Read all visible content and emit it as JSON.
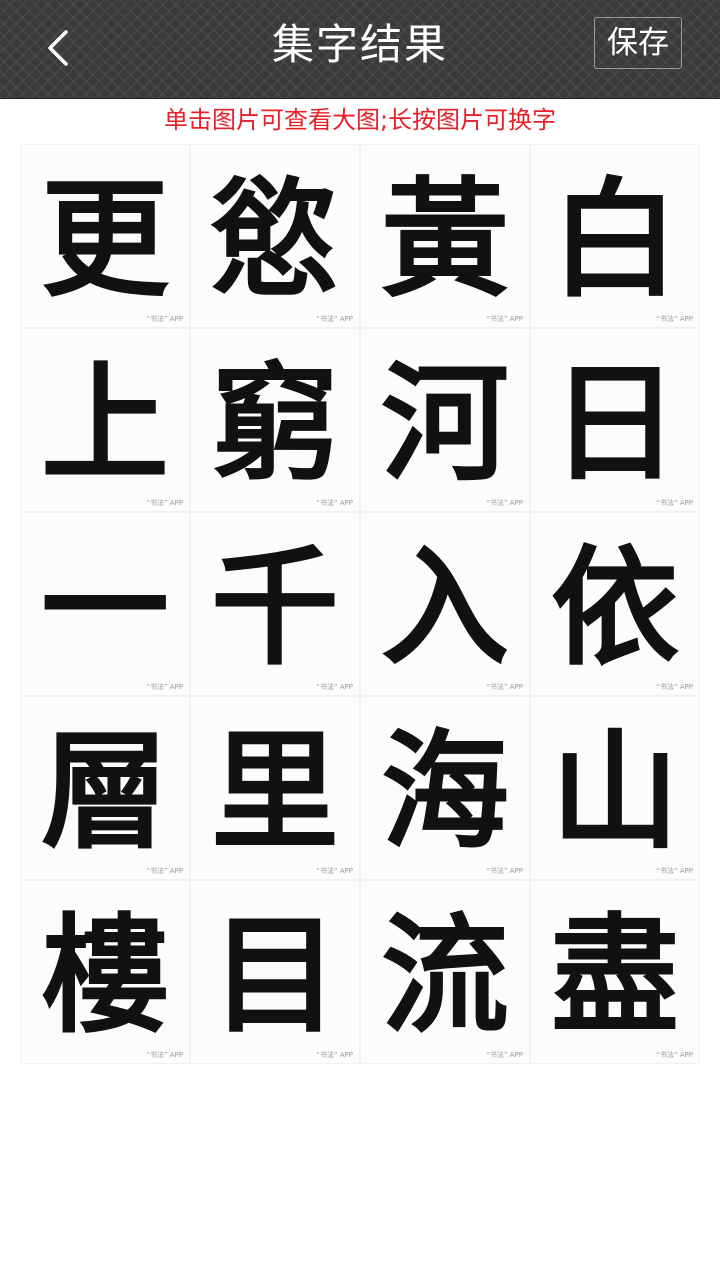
{
  "header": {
    "title": "集字结果",
    "save_label": "保存",
    "back_icon": "chevron-left-icon"
  },
  "hint": "单击图片可查看大图;长按图片可换字",
  "characters": [
    {
      "char": "更",
      "watermark": "“书法” APP"
    },
    {
      "char": "慾",
      "watermark": "“书法” APP"
    },
    {
      "char": "黃",
      "watermark": "“书法” APP"
    },
    {
      "char": "白",
      "watermark": "“书法” APP"
    },
    {
      "char": "上",
      "watermark": "“书法” APP"
    },
    {
      "char": "窮",
      "watermark": "“书法” APP"
    },
    {
      "char": "河",
      "watermark": "“书法” APP"
    },
    {
      "char": "日",
      "watermark": "“书法” APP"
    },
    {
      "char": "一",
      "watermark": "“书法” APP"
    },
    {
      "char": "千",
      "watermark": "“书法” APP"
    },
    {
      "char": "入",
      "watermark": "“书法” APP"
    },
    {
      "char": "依",
      "watermark": "“书法” APP"
    },
    {
      "char": "層",
      "watermark": "“书法” APP"
    },
    {
      "char": "里",
      "watermark": "“书法” APP"
    },
    {
      "char": "海",
      "watermark": "“书法” APP"
    },
    {
      "char": "山",
      "watermark": "“书法” APP"
    },
    {
      "char": "樓",
      "watermark": "“书法” APP"
    },
    {
      "char": "目",
      "watermark": "“书法” APP"
    },
    {
      "char": "流",
      "watermark": "“书法” APP"
    },
    {
      "char": "盡",
      "watermark": "“书法” APP"
    }
  ]
}
